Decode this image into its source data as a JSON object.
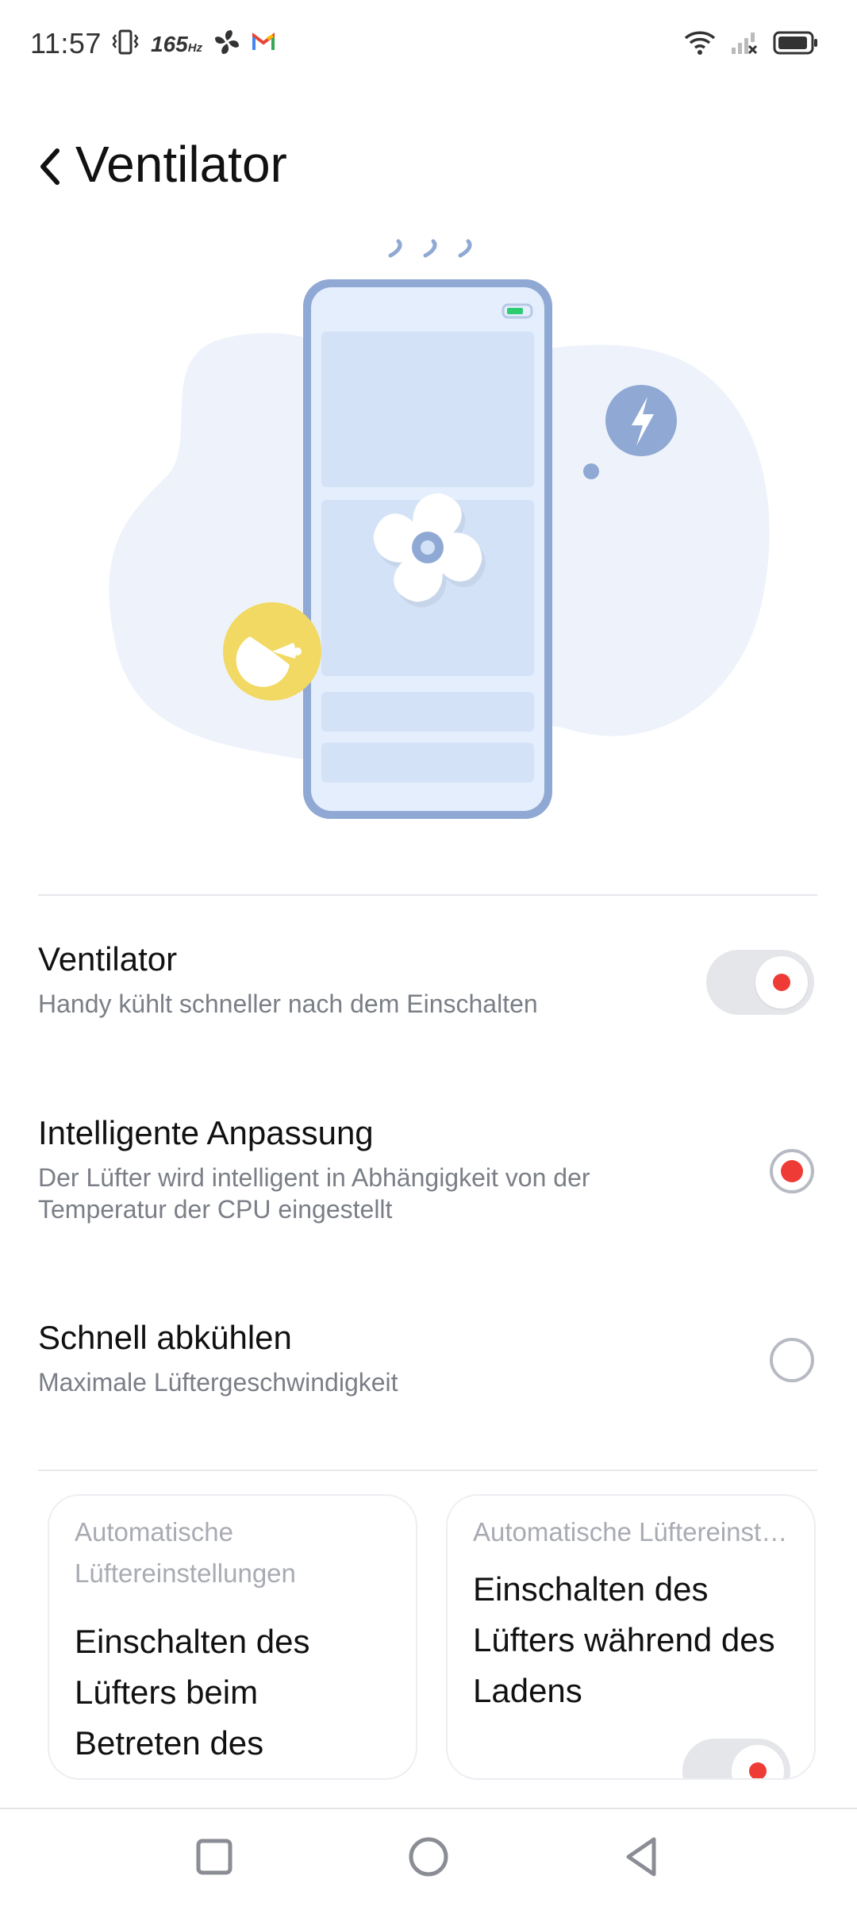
{
  "status_bar": {
    "time": "11:57",
    "refresh_rate": "165",
    "refresh_unit": "Hz",
    "icons_left": [
      "vibrate-icon",
      "fan-icon",
      "gmail-icon"
    ],
    "icons_right": [
      "wifi-icon",
      "no-signal-icon",
      "battery-icon"
    ]
  },
  "header": {
    "title": "Ventilator",
    "back_icon": "chevron-left-icon"
  },
  "settings": {
    "fan": {
      "title": "Ventilator",
      "description": "Handy kühlt schneller nach dem Einschalten",
      "enabled": true
    },
    "smart": {
      "title": "Intelligente Anpassung",
      "description": "Der Lüfter wird intelligent in Abhängigkeit von der Temperatur der CPU eingestellt",
      "selected": true
    },
    "fast": {
      "title": "Schnell abkühlen",
      "description": "Maximale Lüftergeschwindigkeit",
      "selected": false
    }
  },
  "cards": [
    {
      "label": "Automatische Lüftereinstellungen",
      "title": "Einschalten des Lüfters beim Betreten des Spielraums"
    },
    {
      "label": "Automatische Lüftereinstellungen",
      "title": "Einschalten des Lüfters während des Ladens",
      "enabled": true
    }
  ],
  "nav": [
    "recents-square-icon",
    "home-circle-icon",
    "back-triangle-icon"
  ],
  "colors": {
    "accent": "#ef3b36",
    "illustration_blue": "#8fa9d4",
    "pacman_yellow": "#f2d964"
  }
}
